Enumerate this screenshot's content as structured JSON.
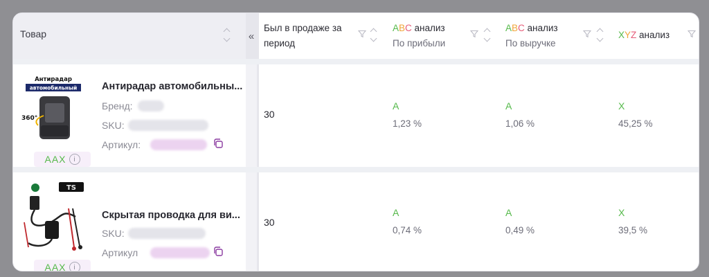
{
  "header": {
    "product_label": "Товар",
    "collapse_label": "«",
    "columns": [
      {
        "id": "sold",
        "line1": "Был в продаже за",
        "line2": "период"
      },
      {
        "id": "abc-profit",
        "letters": [
          "A",
          "B",
          "C"
        ],
        "suffix": " анализ",
        "line2": "По прибыли"
      },
      {
        "id": "abc-revenue",
        "letters": [
          "A",
          "B",
          "C"
        ],
        "suffix": " анализ",
        "line2": "По выручке"
      },
      {
        "id": "xyz",
        "letters": [
          "X",
          "Y",
          "Z"
        ],
        "suffix": " анализ",
        "line2": ""
      }
    ]
  },
  "colors": {
    "grade_a": "#55b94a",
    "grade_b": "#f0a53a",
    "grade_c": "#e65b78"
  },
  "rows": [
    {
      "name": "Антирадар автомобильны...",
      "brand_label": "Бренд:",
      "sku_label": "SKU:",
      "article_label": "Артикул:",
      "abc_badge": "AAX",
      "thumb_text": [
        "Антирадар",
        "автомобильный",
        "360°"
      ],
      "sold_days": "30",
      "abc_profit_grade": "A",
      "abc_profit_pct": "1,23 %",
      "abc_revenue_grade": "A",
      "abc_revenue_pct": "1,06 %",
      "xyz_grade": "X",
      "xyz_pct": "45,25 %"
    },
    {
      "name": "Скрытая проводка для ви...",
      "sku_label": "SKU:",
      "article_label": "Артикул",
      "abc_badge": "AAX",
      "thumb_text": [
        "TS"
      ],
      "sold_days": "30",
      "abc_profit_grade": "A",
      "abc_profit_pct": "0,74 %",
      "abc_revenue_grade": "A",
      "abc_revenue_pct": "0,49 %",
      "xyz_grade": "X",
      "xyz_pct": "39,5 %"
    }
  ]
}
